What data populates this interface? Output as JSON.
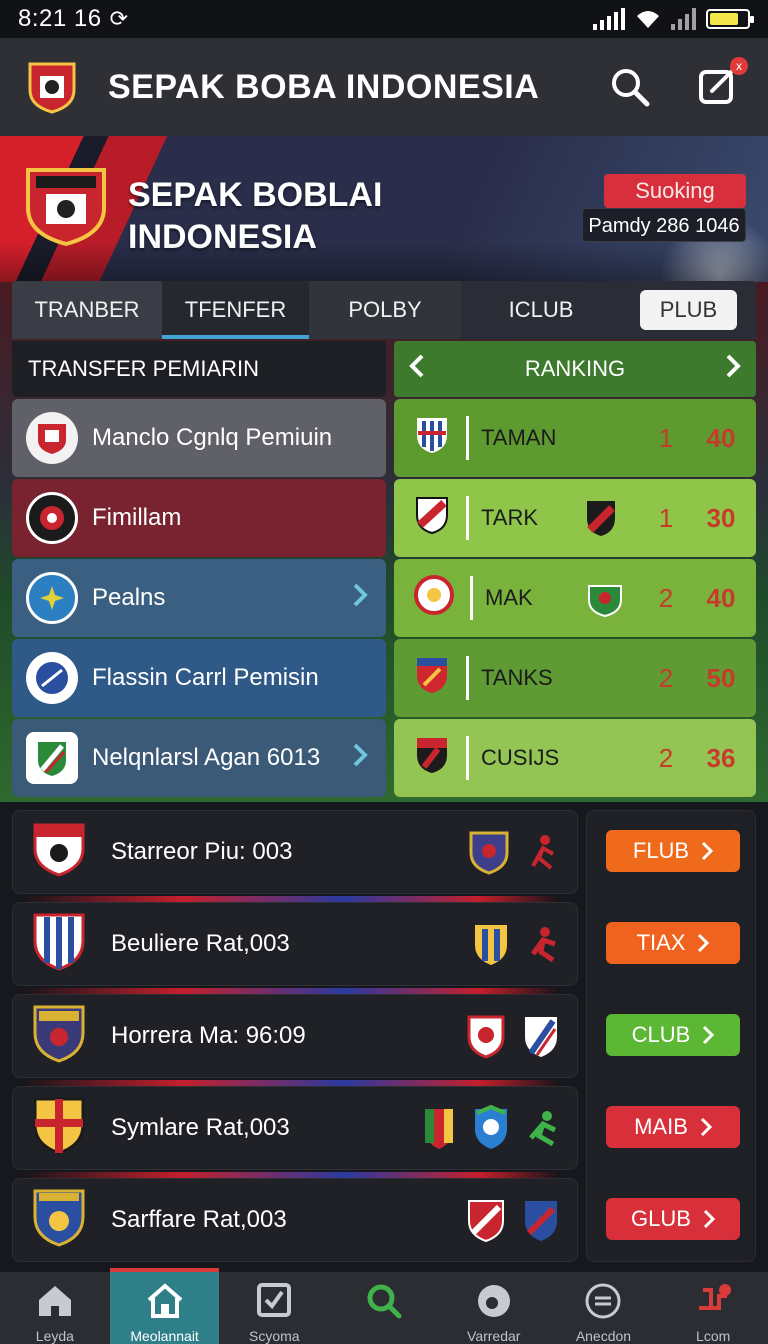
{
  "status_bar": {
    "time": "8:21 16"
  },
  "header": {
    "title": "SEPAK BOBA INDONESIA",
    "notification_badge": "x"
  },
  "hero": {
    "title": "SEPAK BOBLAI INDONESIA",
    "badge": "Suoking",
    "info": "Pamdy 286 1046"
  },
  "tabs": [
    {
      "label": "TRANBER"
    },
    {
      "label": "TFENFER",
      "active": true
    },
    {
      "label": "POLBY"
    },
    {
      "label": "ICLUB"
    },
    {
      "label": "PLUB"
    }
  ],
  "transfer": {
    "heading": "TRANSFER PEMIARIN",
    "items": [
      {
        "label": "Manclo Cgnlq Pemiuin",
        "color": "#5f6068"
      },
      {
        "label": "Fimillam",
        "color": "#7a2330"
      },
      {
        "label": "Pealns",
        "color": "#3b5f80"
      },
      {
        "label": "Flassin Carrl Pemisin",
        "color": "#2f5a87"
      },
      {
        "label": "Nelqnlarsl Agan 6013",
        "color": "#3b5a78"
      }
    ]
  },
  "ranking": {
    "heading": "RANKING",
    "rows": [
      {
        "team": "TAMAN",
        "pos": "1",
        "pts": "40",
        "color": "#5d9a2f"
      },
      {
        "team": "TARK",
        "pos": "1",
        "pts": "30",
        "color": "#8fc64a"
      },
      {
        "team": "MAK",
        "pos": "2",
        "pts": "40",
        "color": "#7ab33c"
      },
      {
        "team": "TANKS",
        "pos": "2",
        "pts": "50",
        "color": "#5f9a34"
      },
      {
        "team": "CUSIJS",
        "pos": "2",
        "pts": "36",
        "color": "#93c454"
      }
    ]
  },
  "matches": [
    {
      "label": "Starreor Piu: 003"
    },
    {
      "label": "Beuliere Rat,003"
    },
    {
      "label": "Horrera Ma: 96:09"
    },
    {
      "label": "Symlare Rat,003"
    },
    {
      "label": "Sarffare Rat,003"
    }
  ],
  "side_buttons": [
    {
      "label": "FLUB",
      "color": "#f06a1c"
    },
    {
      "label": "TIAX",
      "color": "#f0631e"
    },
    {
      "label": "CLUB",
      "color": "#5cb734"
    },
    {
      "label": "MAIB",
      "color": "#d8303a"
    },
    {
      "label": "GLUB",
      "color": "#d8303a"
    }
  ],
  "bottom_nav": [
    {
      "label": "Leyda",
      "icon": "home-icon"
    },
    {
      "label": "Meolannait",
      "icon": "house-icon",
      "active": true
    },
    {
      "label": "Scyoma",
      "icon": "checkbox-icon"
    },
    {
      "label": "",
      "icon": "search-icon"
    },
    {
      "label": "Varredar",
      "icon": "ball-icon"
    },
    {
      "label": "Anecdon",
      "icon": "menu-circle-icon"
    },
    {
      "label": "Lcom",
      "icon": "whistle-icon"
    }
  ],
  "colors": {
    "accent": "#41a4d6",
    "header_bg": "#2e3036",
    "brand_red": "#d7303c"
  }
}
